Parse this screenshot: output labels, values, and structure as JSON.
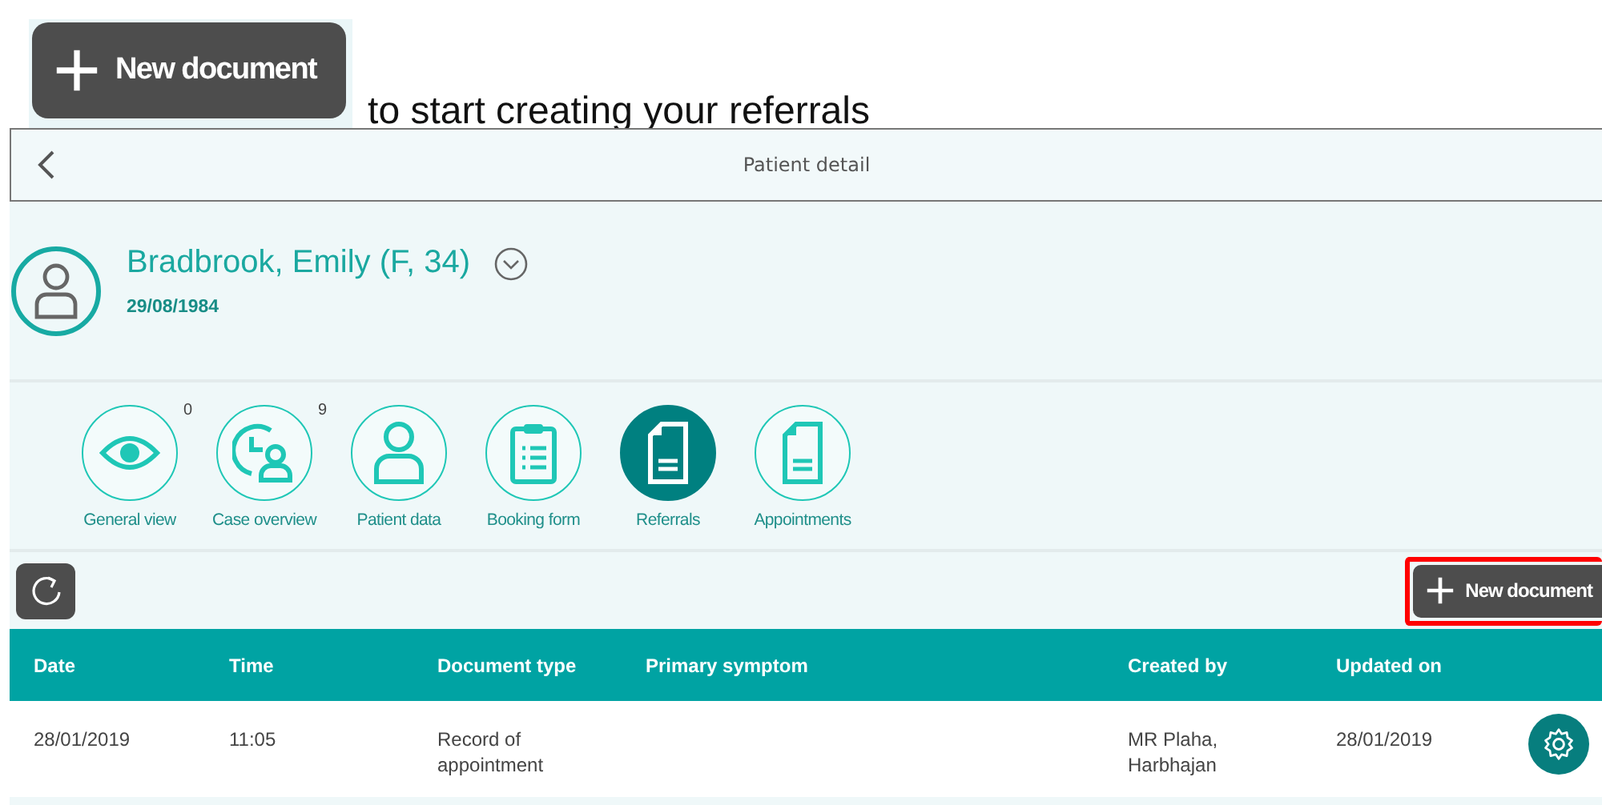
{
  "instruction": {
    "button_label": "New document",
    "text": "to start creating your referrals"
  },
  "header": {
    "title": "Patient detail"
  },
  "patient": {
    "name": "Bradbrook, Emily (F, 34)",
    "birth_date": "29/08/1984"
  },
  "nav": [
    {
      "kind": "eye",
      "label": "General view",
      "count": "0",
      "selected": false
    },
    {
      "kind": "clock-person",
      "label": "Case overview",
      "count": "9",
      "selected": false
    },
    {
      "kind": "person",
      "label": "Patient data",
      "selected": false
    },
    {
      "kind": "clipboard",
      "label": "Booking form",
      "selected": false
    },
    {
      "kind": "document",
      "label": "Referrals",
      "selected": true
    },
    {
      "kind": "document",
      "label": "Appointments",
      "selected": false
    }
  ],
  "toolbar": {
    "new_button": "New document",
    "highlighted": true
  },
  "table": {
    "columns": [
      "Date",
      "Time",
      "Document type",
      "Primary symptom",
      "Created by",
      "Updated on"
    ],
    "rows": [
      {
        "cells": [
          "28/01/2019",
          "11:05",
          "Record of appointment",
          "",
          "MR Plaha, Harbhajan",
          "28/01/2019"
        ]
      }
    ]
  }
}
